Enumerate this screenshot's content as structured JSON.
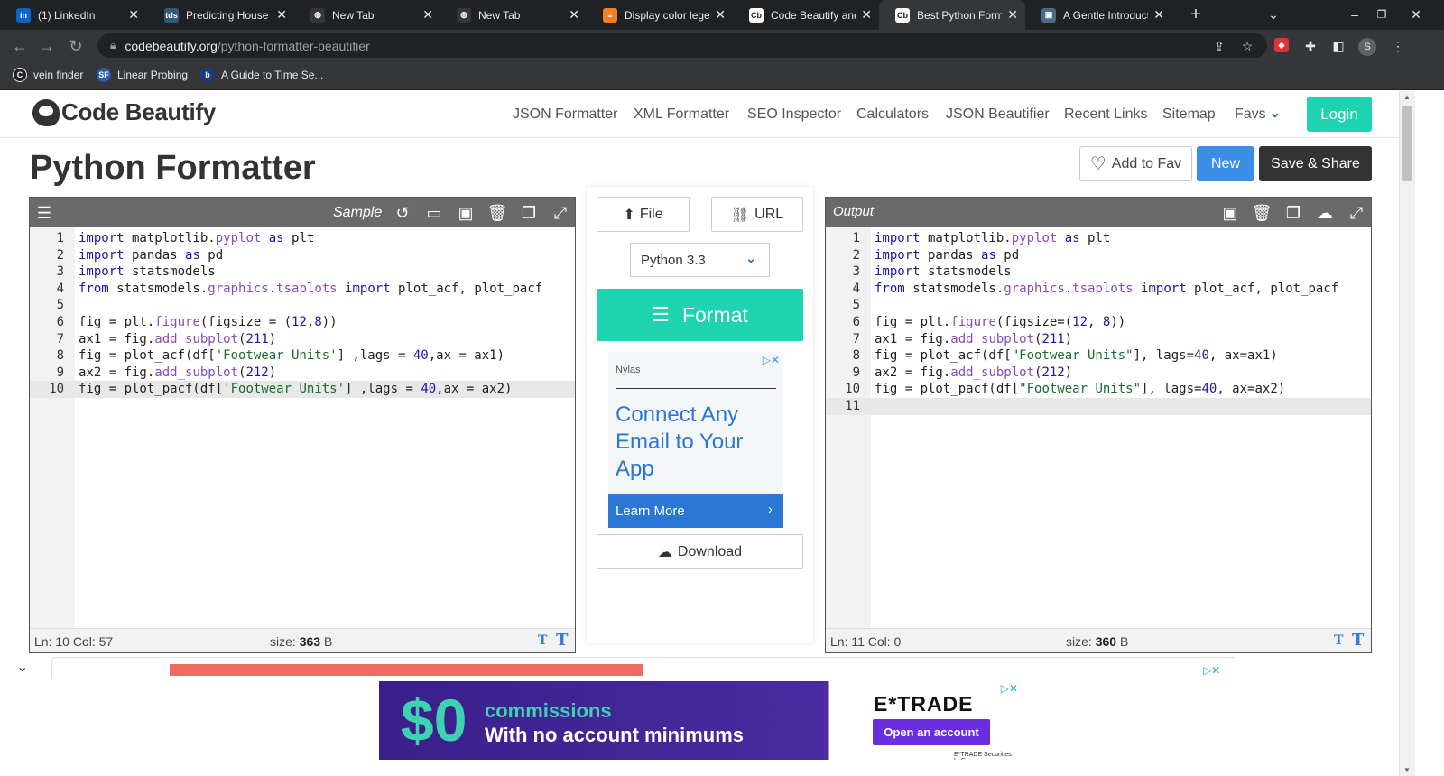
{
  "browser": {
    "tabs": [
      {
        "title": "(1) LinkedIn",
        "icon": "linkedin-icon",
        "fav_text": "in",
        "fav_color": "#0a66c2"
      },
      {
        "title": "Predicting House P",
        "icon": "tds-icon",
        "fav_text": "tds",
        "fav_color": "#355876"
      },
      {
        "title": "New Tab",
        "icon": "globe-icon",
        "fav_text": "◍",
        "fav_color": "#35363a"
      },
      {
        "title": "New Tab",
        "icon": "globe-icon",
        "fav_text": "◍",
        "fav_color": "#35363a"
      },
      {
        "title": "Display color legen",
        "icon": "stackoverflow-icon",
        "fav_text": "≡",
        "fav_color": "#f48024"
      },
      {
        "title": "Code Beautify and",
        "icon": "codebeautify-icon",
        "fav_text": "Cb",
        "fav_color": "#ffffff"
      },
      {
        "title": "Best Python Forma",
        "icon": "codebeautify-icon",
        "fav_text": "Cb",
        "fav_color": "#ffffff",
        "active": true
      },
      {
        "title": "A Gentle Introducti",
        "icon": "image-icon",
        "fav_text": "▣",
        "fav_color": "#4a6a8a"
      }
    ],
    "url_domain": "codebeautify.org",
    "url_path": "/python-formatter-beautifier",
    "profile_initial": "S",
    "bookmarks": [
      {
        "label": "vein finder",
        "icon": "c-logo-icon",
        "fav_text": "C",
        "color": "#202124"
      },
      {
        "label": "Linear Probing",
        "icon": "sf-icon",
        "fav_text": "SF",
        "color": "#2b5fa5"
      },
      {
        "label": "A Guide to Time Se...",
        "icon": "b-logo-icon",
        "fav_text": "b",
        "color": "#1a3a8a"
      }
    ]
  },
  "site": {
    "brand": "Code Beautify",
    "nav": [
      "JSON Formatter",
      "XML Formatter",
      "SEO Inspector",
      "Calculators",
      "JSON Beautifier",
      "Recent Links",
      "Sitemap",
      "Favs"
    ],
    "login_label": "Login"
  },
  "page": {
    "title": "Python Formatter",
    "add_fav_label": "Add to Fav",
    "new_label": "New",
    "save_share_label": "Save & Share"
  },
  "input_editor": {
    "sample_label": "Sample",
    "lines": [
      "import matplotlib.pyplot as plt",
      "import pandas as pd",
      "import statsmodels",
      "from statsmodels.graphics.tsaplots import plot_acf, plot_pacf",
      "",
      "fig = plt.figure(figsize = (12,8))",
      "ax1 = fig.add_subplot(211)",
      "fig = plot_acf(df['Footwear Units'] ,lags = 40,ax = ax1)",
      "ax2 = fig.add_subplot(212)",
      "fig = plot_pacf(df['Footwear Units'] ,lags = 40,ax = ax2)"
    ],
    "active_line": 10,
    "status_pos": "Ln: 10 Col: 57",
    "size_label": "size:",
    "size_value": "363",
    "size_unit": "B"
  },
  "output_editor": {
    "label": "Output",
    "lines": [
      "import matplotlib.pyplot as plt",
      "import pandas as pd",
      "import statsmodels",
      "from statsmodels.graphics.tsaplots import plot_acf, plot_pacf",
      "",
      "fig = plt.figure(figsize=(12, 8))",
      "ax1 = fig.add_subplot(211)",
      "fig = plot_acf(df[\"Footwear Units\"], lags=40, ax=ax1)",
      "ax2 = fig.add_subplot(212)",
      "fig = plot_pacf(df[\"Footwear Units\"], lags=40, ax=ax2)",
      ""
    ],
    "active_line": 11,
    "status_pos": "Ln: 11 Col: 0",
    "size_label": "size:",
    "size_value": "360",
    "size_unit": "B"
  },
  "middle": {
    "file_label": "File",
    "url_label": "URL",
    "version": "Python 3.3",
    "format_label": "Format",
    "download_label": "Download"
  },
  "ad_nylas": {
    "advertiser": "Nylas",
    "headline": "Connect Any Email to Your App",
    "cta": "Learn More"
  },
  "ad_etrade": {
    "big": "$0",
    "line1": "commissions",
    "line2": "With no account minimums",
    "brand": "E*TRADE",
    "cta": "Open an account",
    "fine": "E*TRADE Securities LLC"
  },
  "bottom": {
    "progress_fraction": 0.46
  }
}
